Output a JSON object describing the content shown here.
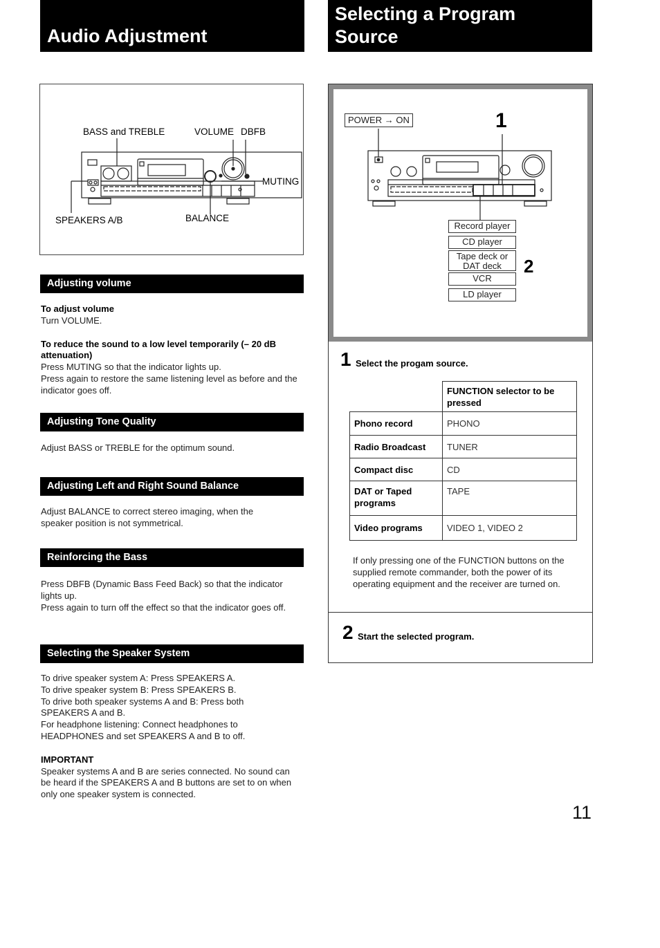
{
  "left": {
    "title": "Audio Adjustment",
    "figure": {
      "labels": {
        "bass_treble": "BASS and TREBLE",
        "volume": "VOLUME",
        "dbfb": "DBFB",
        "muting": "MUTING",
        "speakers": "SPEAKERS A/B",
        "balance": "BALANCE"
      }
    },
    "sections": [
      {
        "heading": "Adjusting volume",
        "blocks": [
          {
            "subhead": "To adjust volume",
            "lines": [
              "Turn VOLUME."
            ]
          },
          {
            "subhead": "To reduce the sound to a low level temporarily (– 20 dB attenuation)",
            "lines": [
              "Press MUTING so that the indicator lights up.",
              "Press again to restore the same listening level as before and the indicator goes off."
            ]
          }
        ]
      },
      {
        "heading": "Adjusting Tone Quality",
        "text": "Adjust BASS or TREBLE for the optimum sound."
      },
      {
        "heading": "Adjusting Left and Right Sound Balance",
        "text": "Adjust BALANCE to correct stereo imaging, when the speaker position is not symmetrical."
      },
      {
        "heading": "Reinforcing the Bass",
        "lines": [
          "Press DBFB (Dynamic Bass Feed Back) so that the indicator lights up.",
          "Press again to turn off the effect so that the indicator goes off."
        ]
      },
      {
        "heading": "Selecting the Speaker System",
        "lines": [
          "To drive speaker system A:  Press SPEAKERS A.",
          "To drive speaker system B:  Press SPEAKERS B.",
          "To drive both speaker systems A and B: Press both SPEAKERS A and B.",
          "For headphone listening: Connect headphones to HEADPHONES and set SPEAKERS A and B to off."
        ],
        "important_label": "IMPORTANT",
        "important_text": "Speaker systems A and B are series connected. No sound can be heard if the SPEAKERS A and B buttons are set to on when only one speaker system is connected."
      }
    ]
  },
  "right": {
    "title_line1": "Selecting a Program",
    "title_line2": "Source",
    "figure": {
      "power_label": "POWER → ON",
      "callout_1": "1",
      "callout_2": "2",
      "sources": [
        "Record player",
        "CD player",
        "Tape deck or DAT deck",
        "VCR",
        "LD player"
      ],
      "source_tape_line1": "Tape deck or",
      "source_tape_line2": "DAT deck"
    },
    "step1": {
      "number": "1",
      "text": "Select the progam source.",
      "table": {
        "header": "FUNCTION selector to be pressed",
        "rows": [
          {
            "source": "Phono record",
            "selector": "PHONO"
          },
          {
            "source": "Radio Broadcast",
            "selector": "TUNER"
          },
          {
            "source": "Compact disc",
            "selector": "CD"
          },
          {
            "source": "DAT or Taped programs",
            "selector": "TAPE"
          },
          {
            "source": "Video programs",
            "selector": "VIDEO 1, VIDEO 2"
          }
        ]
      },
      "note": "If only pressing one of the FUNCTION buttons on the supplied remote commander, both the power of its operating equipment and the receiver are turned on."
    },
    "step2": {
      "number": "2",
      "text": "Start the selected program."
    }
  },
  "page_number": "11"
}
